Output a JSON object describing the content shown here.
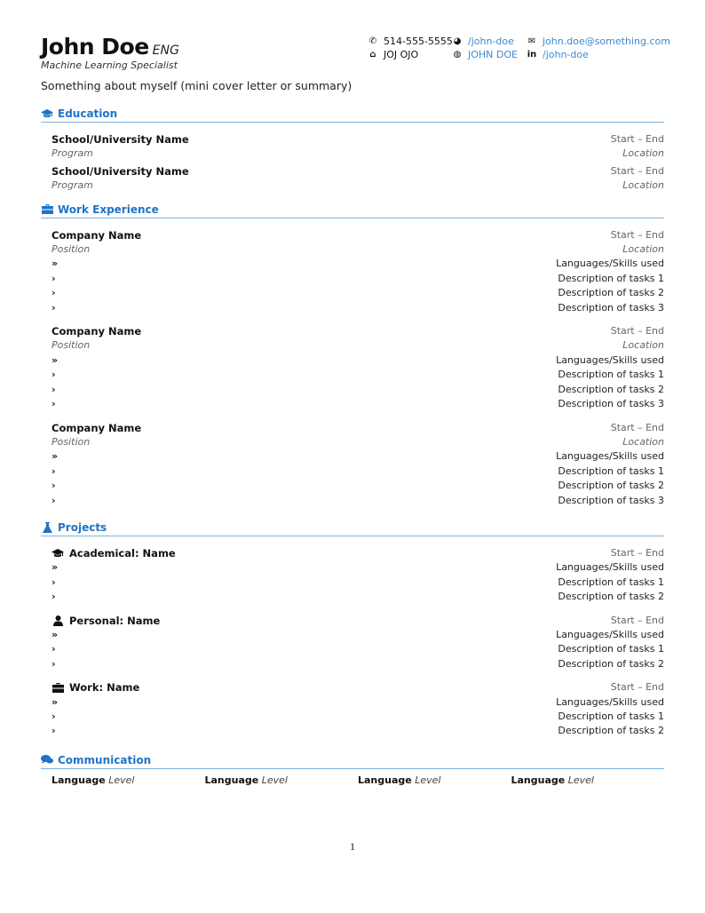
{
  "header": {
    "name": "John Doe",
    "name_suffix": "ENG",
    "subtitle": "Machine Learning Specialist",
    "summary": "Something about myself (mini cover letter or summary)",
    "contacts": [
      {
        "icon": "phone-icon",
        "glyph": "✆",
        "text": "514-555-5555",
        "link": false
      },
      {
        "icon": "github-icon",
        "glyph": "◕",
        "text": "/john-doe",
        "link": true
      },
      {
        "icon": "envelope-icon",
        "glyph": "✉",
        "text": "john.doe@something.com",
        "link": true
      },
      {
        "icon": "home-icon",
        "glyph": "⌂",
        "text": "JOJ OJO",
        "link": false
      },
      {
        "icon": "globe-icon",
        "glyph": "◍",
        "text": "JOHN DOE",
        "link": true
      },
      {
        "icon": "linkedin-icon",
        "glyph": "in",
        "text": "/john-doe",
        "link": true
      }
    ]
  },
  "colors": {
    "accent": "#1f74c8",
    "rule": "#7fb3e0",
    "link": "#3a8ad6",
    "muted": "#666666"
  },
  "education": {
    "title": "Education",
    "icon": "graduation-cap-icon",
    "entries": [
      {
        "name": "School/University Name",
        "dates": "Start – End",
        "program": "Program",
        "location": "Location"
      },
      {
        "name": "School/University Name",
        "dates": "Start – End",
        "program": "Program",
        "location": "Location"
      }
    ]
  },
  "work": {
    "title": "Work Experience",
    "icon": "briefcase-icon",
    "entries": [
      {
        "name": "Company Name",
        "dates": "Start – End",
        "position": "Position",
        "location": "Location",
        "skills": "Languages/Skills used",
        "tasks": [
          "Description of tasks 1",
          "Description of tasks 2",
          "Description of tasks 3"
        ]
      },
      {
        "name": "Company Name",
        "dates": "Start – End",
        "position": "Position",
        "location": "Location",
        "skills": "Languages/Skills used",
        "tasks": [
          "Description of tasks 1",
          "Description of tasks 2",
          "Description of tasks 3"
        ]
      },
      {
        "name": "Company Name",
        "dates": "Start – End",
        "position": "Position",
        "location": "Location",
        "skills": "Languages/Skills used",
        "tasks": [
          "Description of tasks 1",
          "Description of tasks 2",
          "Description of tasks 3"
        ]
      }
    ]
  },
  "projects": {
    "title": "Projects",
    "icon": "flask-icon",
    "entries": [
      {
        "icon": "graduation-cap-icon",
        "name": "Academical: Name",
        "dates": "Start – End",
        "skills": "Languages/Skills used",
        "tasks": [
          "Description of tasks 1",
          "Description of tasks 2"
        ]
      },
      {
        "icon": "user-icon",
        "name": "Personal: Name",
        "dates": "Start – End",
        "skills": "Languages/Skills used",
        "tasks": [
          "Description of tasks 1",
          "Description of tasks 2"
        ]
      },
      {
        "icon": "briefcase-icon",
        "name": "Work: Name",
        "dates": "Start – End",
        "skills": "Languages/Skills used",
        "tasks": [
          "Description of tasks 1",
          "Description of tasks 2"
        ]
      }
    ]
  },
  "communication": {
    "title": "Communication",
    "icon": "comments-icon",
    "languages": [
      {
        "language": "Language",
        "level": "Level"
      },
      {
        "language": "Language",
        "level": "Level"
      },
      {
        "language": "Language",
        "level": "Level"
      },
      {
        "language": "Language",
        "level": "Level"
      }
    ]
  },
  "page_number": "1"
}
